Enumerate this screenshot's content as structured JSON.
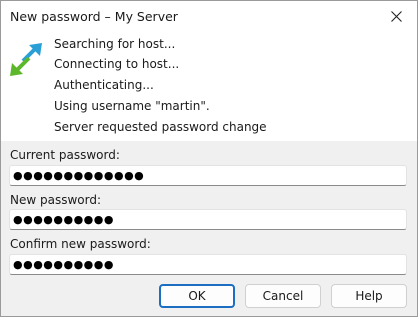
{
  "window": {
    "title": "New password – My Server"
  },
  "log": {
    "lines": [
      "Searching for host...",
      "Connecting to host...",
      "Authenticating...",
      "Using username \"martin\".",
      "Server requested password change"
    ]
  },
  "form": {
    "current_label": "Current password:",
    "current_value": "●●●●●●●●●●●●●",
    "new_label": "New password:",
    "new_value": "●●●●●●●●●●",
    "confirm_label": "Confirm new password:",
    "confirm_value": "●●●●●●●●●●"
  },
  "buttons": {
    "ok": "OK",
    "cancel": "Cancel",
    "help": "Help"
  },
  "icons": {
    "close": "close-icon",
    "logo": "transfer-arrows-icon"
  },
  "colors": {
    "accent": "#1b6ec2",
    "arrow_blue": "#2a9fd6",
    "arrow_green": "#5cb82a"
  }
}
